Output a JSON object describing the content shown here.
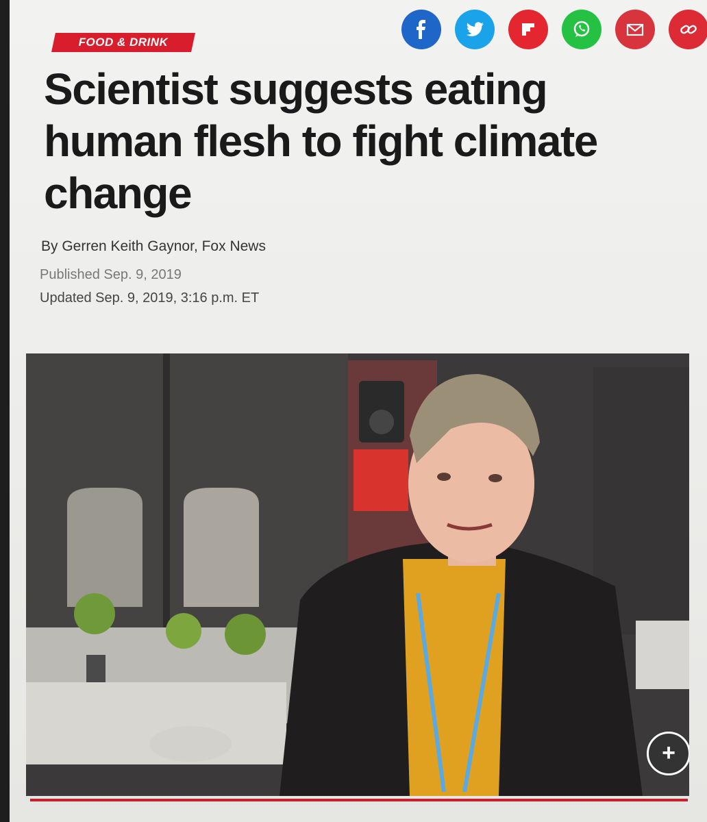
{
  "article": {
    "category": "FOOD & DRINK",
    "headline": "Scientist suggests eating human flesh to fight climate change",
    "byline": "By Gerren Keith Gaynor, Fox News",
    "published": "Published Sep. 9, 2019",
    "updated": "Updated Sep. 9, 2019, 3:16 p.m. ET"
  },
  "share": [
    {
      "name": "facebook",
      "icon": "facebook-icon",
      "color": "#1e66c7"
    },
    {
      "name": "twitter",
      "icon": "twitter-icon",
      "color": "#1aa3e8"
    },
    {
      "name": "flipboard",
      "icon": "flipboard-icon",
      "color": "#e3262f"
    },
    {
      "name": "whatsapp",
      "icon": "whatsapp-icon",
      "color": "#25c142"
    },
    {
      "name": "email",
      "icon": "email-icon",
      "color": "#d8343d"
    },
    {
      "name": "copy-link",
      "icon": "link-icon",
      "color": "#dc2b34"
    }
  ],
  "media": {
    "expand_icon": "plus-icon",
    "accent_color": "#c8202a"
  }
}
